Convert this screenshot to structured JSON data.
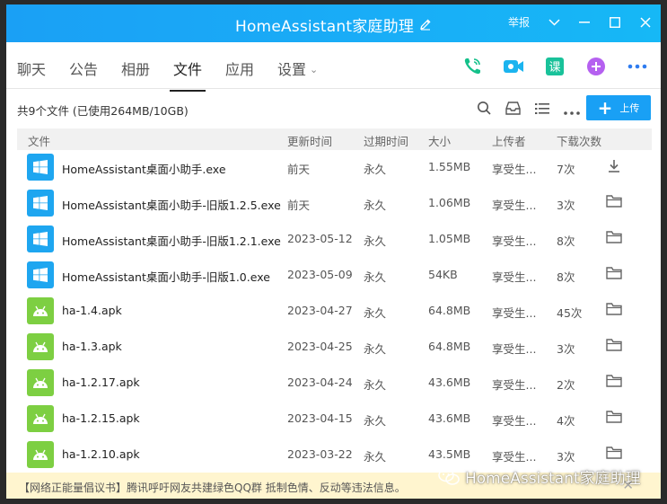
{
  "window": {
    "title": "HomeAssistant家庭助理",
    "report_label": "举报",
    "title_icon": "edit-pencil-icon",
    "accent_color": "#19a0f5"
  },
  "tabs": [
    {
      "label": "聊天"
    },
    {
      "label": "公告"
    },
    {
      "label": "相册"
    },
    {
      "label": "文件"
    },
    {
      "label": "应用"
    },
    {
      "label": "设置"
    }
  ],
  "app_icons": [
    "phone-icon",
    "video-call-icon",
    "lesson-icon",
    "add-app-icon",
    "more-icon"
  ],
  "toolbar": {
    "file_count": "共9个文件 (已使用264MB/10GB)",
    "upload_label": "上传"
  },
  "table": {
    "headers": {
      "name": "文件",
      "date": "更新时间",
      "expire": "过期时间",
      "size": "大小",
      "uploader": "上传者",
      "downloads": "下载次数"
    },
    "rows": [
      {
        "name": "HomeAssistant桌面小助手.exe",
        "date": "前天",
        "expire": "永久",
        "size": "1.55MB",
        "uploader": "享受生...",
        "downloads": "7次",
        "type": "exe",
        "action": "download-icon"
      },
      {
        "name": "HomeAssistant桌面小助手-旧版1.2.5.exe",
        "date": "前天",
        "expire": "永久",
        "size": "1.06MB",
        "uploader": "享受生...",
        "downloads": "3次",
        "type": "exe",
        "action": "folder-icon"
      },
      {
        "name": "HomeAssistant桌面小助手-旧版1.2.1.exe",
        "date": "2023-05-12",
        "expire": "永久",
        "size": "1.05MB",
        "uploader": "享受生...",
        "downloads": "8次",
        "type": "exe",
        "action": "folder-icon"
      },
      {
        "name": "HomeAssistant桌面小助手-旧版1.0.exe",
        "date": "2023-05-09",
        "expire": "永久",
        "size": "54KB",
        "uploader": "享受生...",
        "downloads": "8次",
        "type": "exe",
        "action": "folder-icon"
      },
      {
        "name": "ha-1.4.apk",
        "date": "2023-04-27",
        "expire": "永久",
        "size": "64.8MB",
        "uploader": "享受生...",
        "downloads": "45次",
        "type": "apk",
        "action": "folder-icon"
      },
      {
        "name": "ha-1.3.apk",
        "date": "2023-04-25",
        "expire": "永久",
        "size": "64.8MB",
        "uploader": "享受生...",
        "downloads": "3次",
        "type": "apk",
        "action": "folder-icon"
      },
      {
        "name": "ha-1.2.17.apk",
        "date": "2023-04-24",
        "expire": "永久",
        "size": "43.6MB",
        "uploader": "享受生...",
        "downloads": "2次",
        "type": "apk",
        "action": "folder-icon"
      },
      {
        "name": "ha-1.2.15.apk",
        "date": "2023-04-15",
        "expire": "永久",
        "size": "43.6MB",
        "uploader": "享受生...",
        "downloads": "4次",
        "type": "apk",
        "action": "folder-icon"
      },
      {
        "name": "ha-1.2.10.apk",
        "date": "2023-03-22",
        "expire": "永久",
        "size": "43.5MB",
        "uploader": "享受生...",
        "downloads": "3次",
        "type": "apk",
        "action": "folder-icon"
      }
    ]
  },
  "notice": {
    "text": "【网络正能量倡议书】腾讯呼吁网友共建绿色QQ群 抵制色情、反动等违法信息。"
  },
  "watermark": {
    "text": "HomeAssistant家庭助理"
  },
  "colors": {
    "exe_icon": "#1ea6f0",
    "apk_icon": "#7dcf42",
    "notice_bg": "#fff5cf"
  }
}
